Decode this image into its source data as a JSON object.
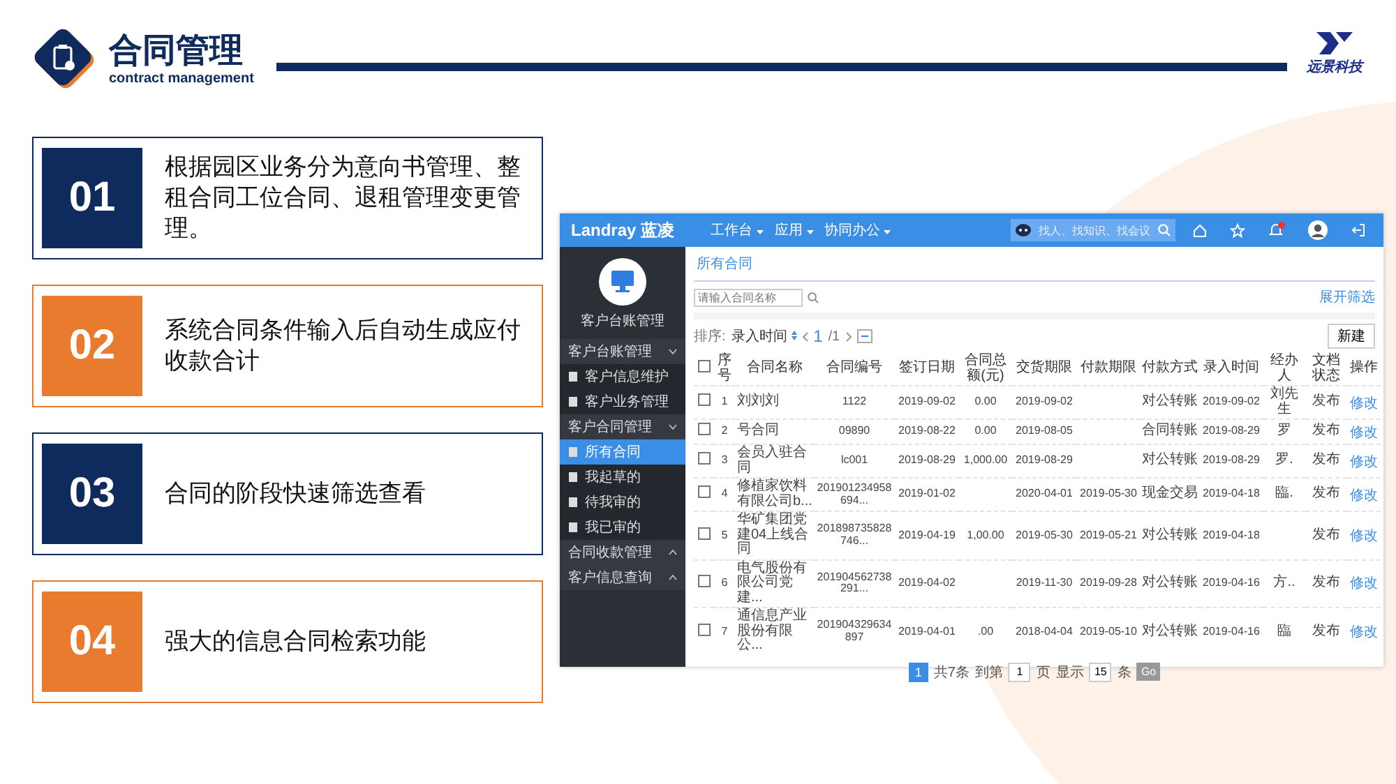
{
  "header": {
    "title": "合同管理",
    "subtitle": "contract management",
    "logo_text": "远景科技"
  },
  "features": [
    {
      "number": "01",
      "text": "根据园区业务分为意向书管理、整租合同工位合同、退租管理变更管理。",
      "color": "#0f2a5c"
    },
    {
      "number": "02",
      "text": "系统合同条件输入后自动生成应付收款合计",
      "color": "#e87b2e"
    },
    {
      "number": "03",
      "text": "合同的阶段快速筛选查看",
      "color": "#0f2a5c"
    },
    {
      "number": "04",
      "text": "强大的信息合同检索功能",
      "color": "#e87b2e"
    }
  ],
  "app": {
    "brand": "Landray 蓝凌",
    "nav": [
      "工作台",
      "应用",
      "协同办公"
    ],
    "search_placeholder": "找人、找知识、找会议",
    "sidebar": {
      "profile_name": "客户台账管理",
      "items": [
        {
          "label": "客户台账管理",
          "kind": "group",
          "expanded": true,
          "selected": false
        },
        {
          "label": "客户信息维护",
          "kind": "item",
          "selected": false
        },
        {
          "label": "客户业务管理",
          "kind": "item",
          "selected": false
        },
        {
          "label": "客户合同管理",
          "kind": "group",
          "expanded": true,
          "selected": false
        },
        {
          "label": "所有合同",
          "kind": "item",
          "selected": true
        },
        {
          "label": "我起草的",
          "kind": "item",
          "selected": false
        },
        {
          "label": "待我审的",
          "kind": "item",
          "selected": false
        },
        {
          "label": "我已审的",
          "kind": "item",
          "selected": false
        },
        {
          "label": "合同收款管理",
          "kind": "group",
          "expanded": false,
          "selected": false
        },
        {
          "label": "客户信息查询",
          "kind": "group",
          "expanded": false,
          "selected": false
        }
      ]
    },
    "page_title": "所有合同",
    "filter_placeholder": "请输入合同名称",
    "expand_filter": "展开筛选",
    "sort_label": "排序:",
    "sort_field": "录入时间",
    "page_current": "1",
    "page_total": "/1",
    "new_button": "新建",
    "table": {
      "select_all": false,
      "columns": [
        "序号",
        "合同名称",
        "合同编号",
        "签订日期",
        "合同总额(元)",
        "交货期限",
        "付款期限",
        "付款方式",
        "录入时间",
        "经办人",
        "文档状态",
        "操作"
      ],
      "rows": [
        {
          "checked": false,
          "cells": [
            "1",
            "刘刘刘",
            "1122",
            "2019-09-02",
            "0.00",
            "2019-09-02",
            "",
            "对公转账",
            "2019-09-02",
            "刘先生",
            "发布",
            "修改"
          ]
        },
        {
          "checked": false,
          "cells": [
            "2",
            "号合同",
            "09890",
            "2019-08-22",
            "0.00",
            "2019-08-05",
            "",
            "合同转账",
            "2019-08-29",
            "罗",
            "发布",
            "修改"
          ]
        },
        {
          "checked": false,
          "cells": [
            "3",
            "会员入驻合同",
            "lc001",
            "2019-08-29",
            "1,000.00",
            "2019-08-29",
            "",
            "对公转账",
            "2019-08-29",
            "罗.",
            "发布",
            "修改"
          ]
        },
        {
          "checked": false,
          "cells": [
            "4",
            "修植家饮料有限公司b...",
            "201901234958694...",
            "2019-01-02",
            "",
            "2020-04-01",
            "2019-05-30",
            "现金交易",
            "2019-04-18",
            "臨.",
            "发布",
            "修改"
          ]
        },
        {
          "checked": false,
          "cells": [
            "5",
            "华矿集团党建04上线合同",
            "201898735828746...",
            "2019-04-19",
            "1,00.00",
            "2019-05-30",
            "2019-05-21",
            "对公转账",
            "2019-04-18",
            "",
            "发布",
            "修改"
          ]
        },
        {
          "checked": false,
          "cells": [
            "6",
            "电气股份有限公司党建...",
            "201904562738291...",
            "2019-04-02",
            "",
            "2019-11-30",
            "2019-09-28",
            "对公转账",
            "2019-04-16",
            "方..",
            "发布",
            "修改"
          ]
        },
        {
          "checked": false,
          "cells": [
            "7",
            "通信息产业股份有限公...",
            "201904329634897",
            "2019-04-01",
            ".00",
            "2018-04-04",
            "2019-05-10",
            "对公转账",
            "2019-04-16",
            "臨",
            "发布",
            "修改"
          ]
        }
      ]
    },
    "pagination": {
      "pages": [
        {
          "label": "1",
          "selected": true
        }
      ],
      "total": "共7条",
      "goto_label": "到第",
      "goto_value": "1",
      "page_unit": "页",
      "show_label": "显示",
      "page_size": "15",
      "size_unit": "条",
      "go": "Go"
    }
  }
}
